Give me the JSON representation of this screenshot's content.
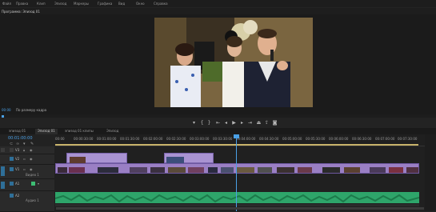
{
  "menu": [
    "Файл",
    "Правка",
    "Клип",
    "Эпизод",
    "Маркеры",
    "Графика",
    "Вид",
    "Окно",
    "Справка"
  ],
  "monitor": {
    "tab_label": "Программа: Эпизод 01",
    "info_label": "",
    "left_timecode": "00:00",
    "fit_label": "По размеру кадра",
    "transport_icons": [
      "marker-icon",
      "in-point-icon",
      "out-point-icon",
      "go-to-in-icon",
      "step-back-icon",
      "play-icon",
      "step-forward-icon",
      "go-to-out-icon",
      "lift-icon",
      "extract-icon",
      "export-frame-icon"
    ]
  },
  "timeline": {
    "tabs": [
      {
        "label": "эпизод 01",
        "active": false
      },
      {
        "label": "Эпизод 01",
        "active": true
      },
      {
        "label": "эпизод 01 клипы",
        "active": false
      },
      {
        "label": "Эпизод",
        "active": false
      }
    ],
    "timecode": "00:01:00:00",
    "ruler_ticks": [
      "00:00",
      "00:00:30:00",
      "00:01:00:00",
      "00:01:30:00",
      "00:02:00:00",
      "00:02:30:00",
      "00:03:00:00",
      "00:03:30:00",
      "00:04:00:00",
      "00:04:30:00",
      "00:05:00:00",
      "00:05:30:00",
      "00:06:00:00",
      "00:06:30:00",
      "00:07:00:00",
      "00:07:30:00"
    ],
    "tracks": [
      {
        "id": "V3",
        "name": ""
      },
      {
        "id": "V2",
        "name": ""
      },
      {
        "id": "V1",
        "name": "Видео 1"
      },
      {
        "id": "A1",
        "name": "Аудио 1"
      },
      {
        "id": "A2",
        "name": ""
      }
    ]
  },
  "colors": {
    "accent_blue": "#2f6f98",
    "timecode_blue": "#4aa0e6",
    "video_clip": "#9a7fc4",
    "audio_clip": "#2ea56a",
    "work_area": "#c8b36a"
  }
}
